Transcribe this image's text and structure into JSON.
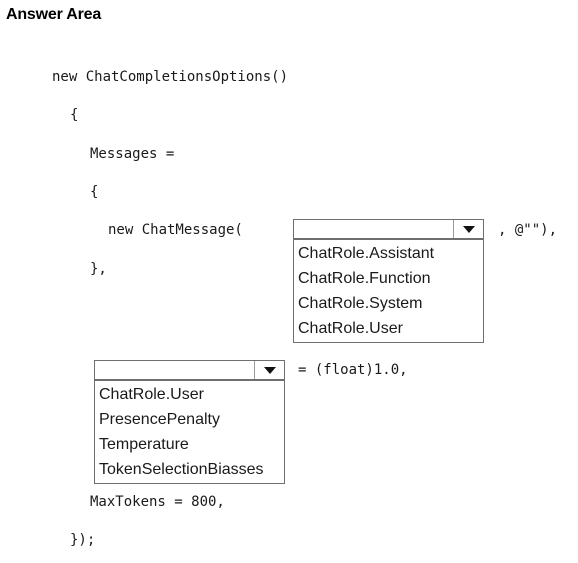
{
  "header": {
    "title": "Answer Area"
  },
  "code": {
    "line1": "new ChatCompletionsOptions()",
    "line2": "{",
    "line3": "Messages =",
    "line4": "{",
    "line5_prefix": "new ChatMessage(",
    "line5_suffix": ", @\"\"),",
    "line6": "},",
    "line7_suffix": "= (float)1.0,",
    "line8": "MaxTokens = 800,",
    "line9": "});"
  },
  "dropdown1": {
    "selected": "",
    "options": [
      "ChatRole.Assistant",
      "ChatRole.Function",
      "ChatRole.System",
      "ChatRole.User"
    ]
  },
  "dropdown2": {
    "selected": "",
    "options": [
      "ChatRole.User",
      "PresencePenalty",
      "Temperature",
      "TokenSelectionBiasses"
    ]
  }
}
